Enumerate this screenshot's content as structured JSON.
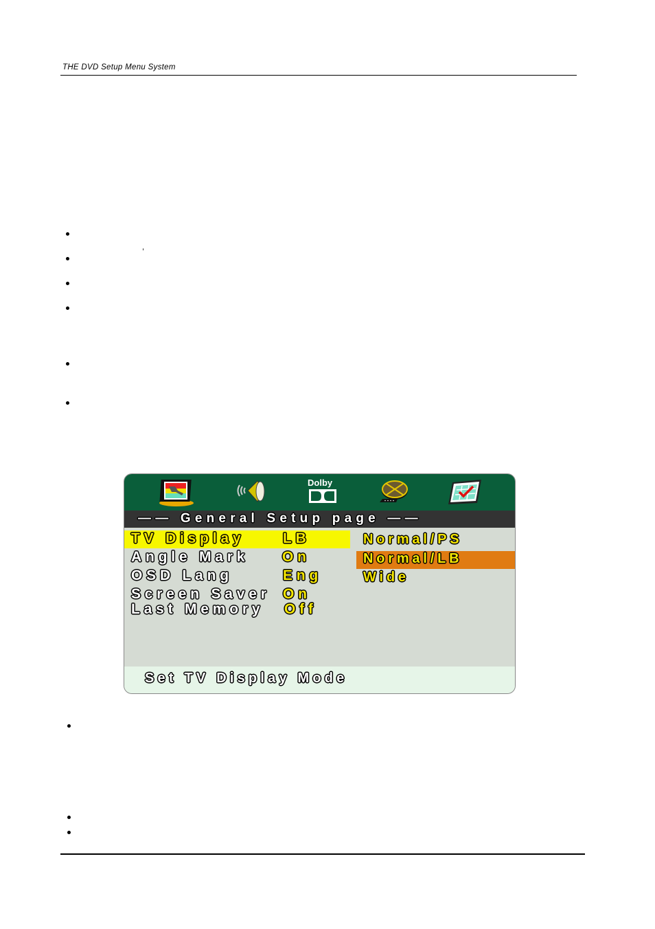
{
  "page": {
    "header_title": "THE DVD Setup Menu System",
    "stray_comma": ","
  },
  "osd_menu": {
    "title": "—— General Setup page ——",
    "icons": [
      {
        "name": "tv-setup-icon",
        "label": ""
      },
      {
        "name": "speaker-audio-icon",
        "label": ""
      },
      {
        "name": "dolby-icon",
        "label": "Dolby"
      },
      {
        "name": "film-reel-video-icon",
        "label": ""
      },
      {
        "name": "preference-checklist-icon",
        "label": ""
      }
    ],
    "items": [
      {
        "label": "TV Display",
        "value": "LB",
        "selected": true
      },
      {
        "label": "Angle Mark",
        "value": "On",
        "selected": false
      },
      {
        "label": "OSD Lang",
        "value": "Eng",
        "selected": false
      },
      {
        "label": "Screen Saver",
        "value": "On",
        "selected": false
      },
      {
        "label": "Last Memory",
        "value": "Off",
        "selected": false
      }
    ],
    "options": [
      {
        "label": "Normal/PS",
        "highlighted": false
      },
      {
        "label": "Normal/LB",
        "highlighted": true
      },
      {
        "label": "Wide",
        "highlighted": false
      }
    ],
    "status": "Set TV Display Mode",
    "colors": {
      "top_bar": "#0a5e3a",
      "title_bar": "#333333",
      "body": "#d5dbd3",
      "status_bar": "#e6f5e8",
      "selected_row": "#f7f700",
      "highlighted_option": "#e07b12",
      "value_text": "#f5e600"
    }
  }
}
